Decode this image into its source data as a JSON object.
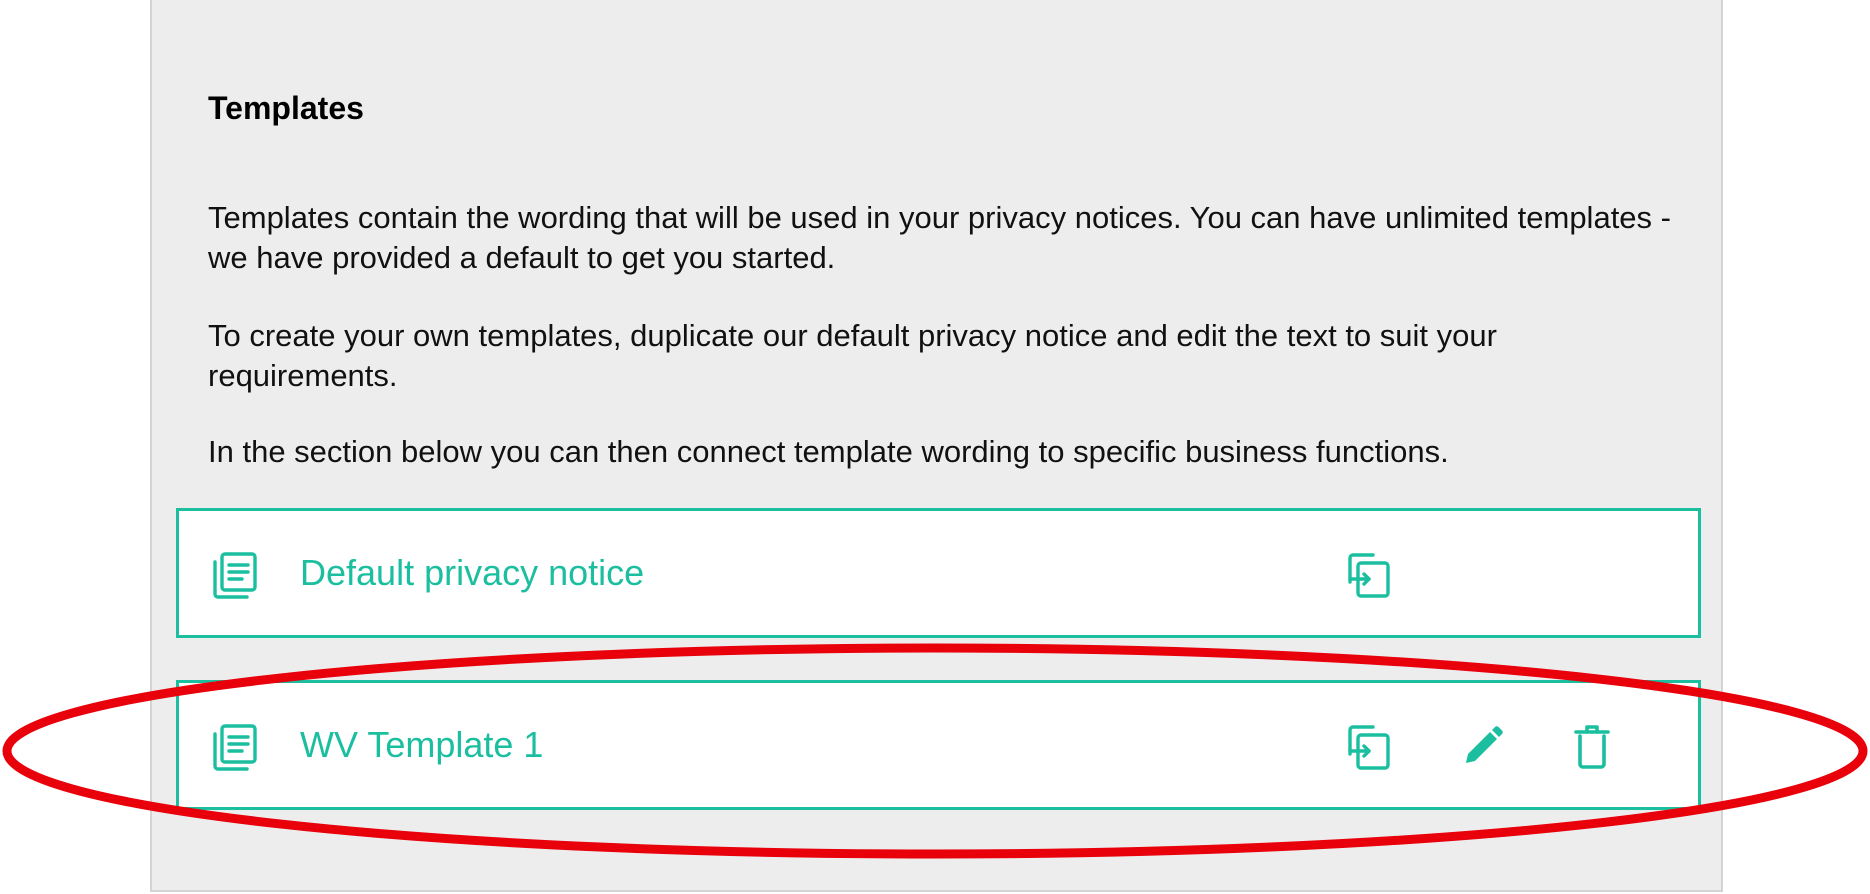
{
  "section": {
    "title": "Templates",
    "paragraphs": [
      "Templates contain the wording that will be used in your privacy notices. You can have unlimited templates - we have provided a default to get you started.",
      "To create your own templates, duplicate our default privacy notice and edit the text to suit your requirements.",
      "In the section below you can then connect template wording to specific business functions."
    ]
  },
  "templates": [
    {
      "label": "Default privacy notice",
      "actions": [
        "duplicate-icon"
      ]
    },
    {
      "label": "WV Template 1",
      "actions": [
        "duplicate-icon",
        "pencil-icon",
        "trash-icon"
      ]
    }
  ],
  "colors": {
    "accent": "#1bbf9f",
    "panel_bg": "#ededed",
    "callout": "#e8000b"
  }
}
